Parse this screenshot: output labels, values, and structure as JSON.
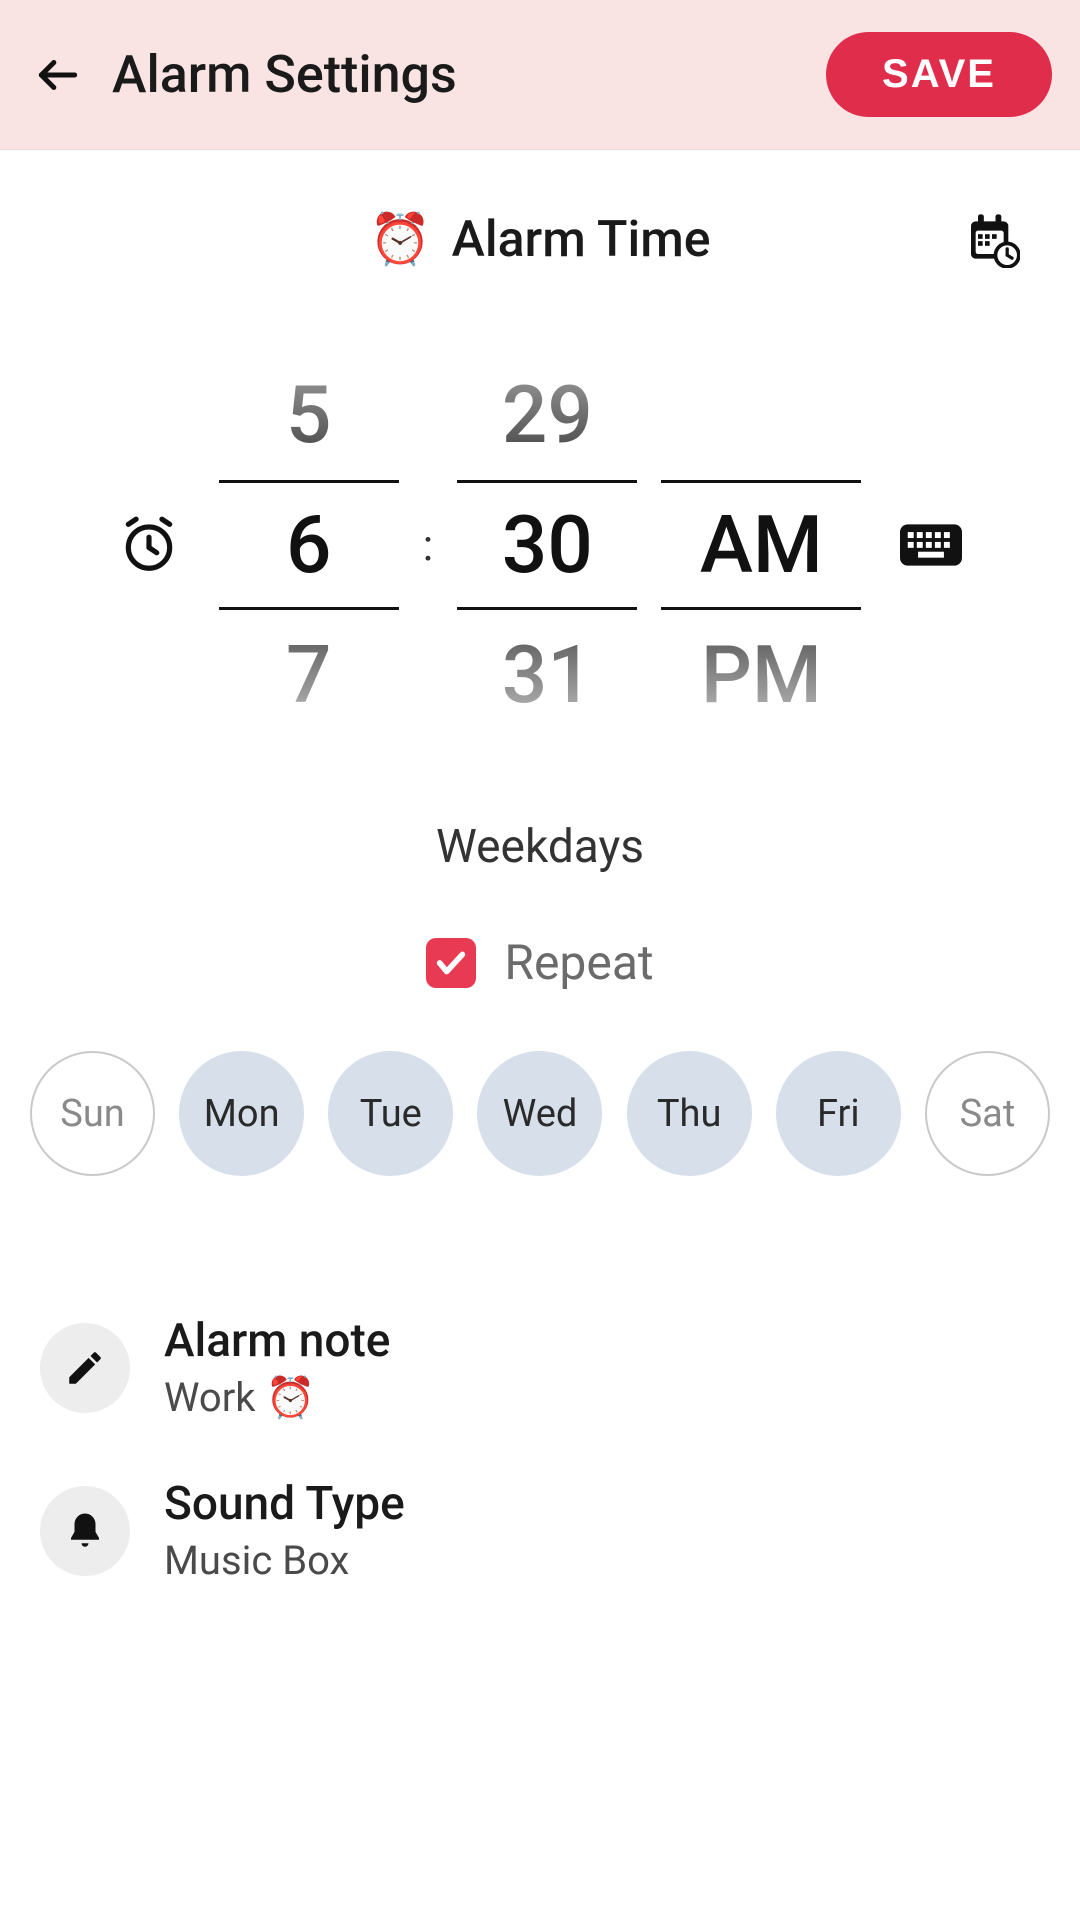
{
  "header": {
    "title": "Alarm Settings",
    "save_label": "SAVE"
  },
  "section": {
    "title": "Alarm Time"
  },
  "time_picker": {
    "hour_prev": "5",
    "hour_selected": "6",
    "hour_next": "7",
    "minute_prev": "29",
    "minute_selected": "30",
    "minute_next": "31",
    "period_prev": "",
    "period_selected": "AM",
    "period_next": "PM",
    "colon": ":"
  },
  "weekdays_label": "Weekdays",
  "repeat": {
    "label": "Repeat",
    "checked": true
  },
  "days": [
    {
      "label": "Sun",
      "selected": false
    },
    {
      "label": "Mon",
      "selected": true
    },
    {
      "label": "Tue",
      "selected": true
    },
    {
      "label": "Wed",
      "selected": true
    },
    {
      "label": "Thu",
      "selected": true
    },
    {
      "label": "Fri",
      "selected": true
    },
    {
      "label": "Sat",
      "selected": false
    }
  ],
  "settings": {
    "alarm_note": {
      "title": "Alarm note",
      "value": "Work ⏰"
    },
    "sound_type": {
      "title": "Sound Type",
      "value": "Music Box"
    }
  }
}
